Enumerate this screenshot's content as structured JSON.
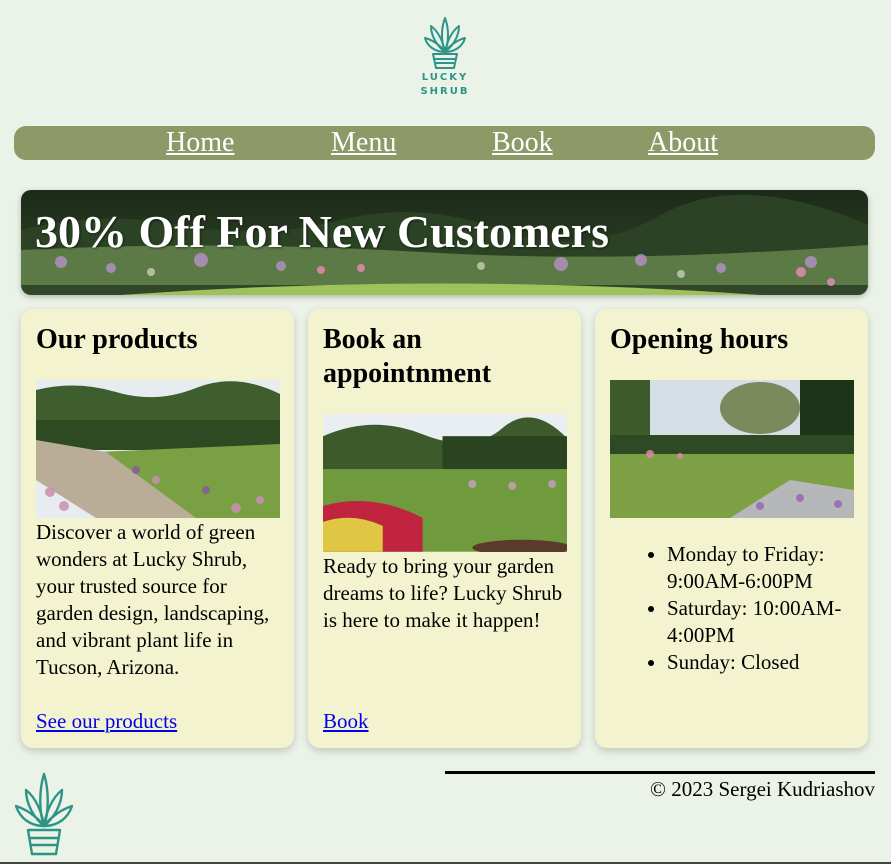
{
  "brand": {
    "logo_text_line1": "LUCKY",
    "logo_text_line2": "SHRUB",
    "logo_icon": "succulent-plant-icon",
    "logo_color": "#2f9488"
  },
  "nav": {
    "background": "#8d9a68",
    "items": [
      {
        "label": "Home"
      },
      {
        "label": "Menu"
      },
      {
        "label": "Book"
      },
      {
        "label": "About"
      }
    ]
  },
  "hero": {
    "headline": "30% Off For New Customers",
    "image": "garden-border-photo"
  },
  "cards": {
    "products": {
      "title": "Our products",
      "image": "garden-lawn-path-photo",
      "text": "Discover a world of green wonders at Lucky Shrub, your trusted source for garden design, landscaping, and vibrant plant life in Tucson, Arizona.",
      "link": "See our products"
    },
    "book": {
      "title": "Book an appointnment",
      "image": "garden-flowerbed-photo",
      "text": "Ready to bring your garden dreams to life? Lucky Shrub is here to make it happen!",
      "link": "Book"
    },
    "hours": {
      "title": "Opening hours",
      "image": "walled-garden-lawn-photo",
      "items": [
        "Monday to Friday: 9:00AM-6:00PM",
        "Saturday: 10:00AM-4:00PM",
        "Sunday: Closed"
      ]
    },
    "background": "#f3f3cf"
  },
  "footer": {
    "copyright": "© 2023 Sergei Kudriashov"
  },
  "page_background": "#ebf3e8"
}
